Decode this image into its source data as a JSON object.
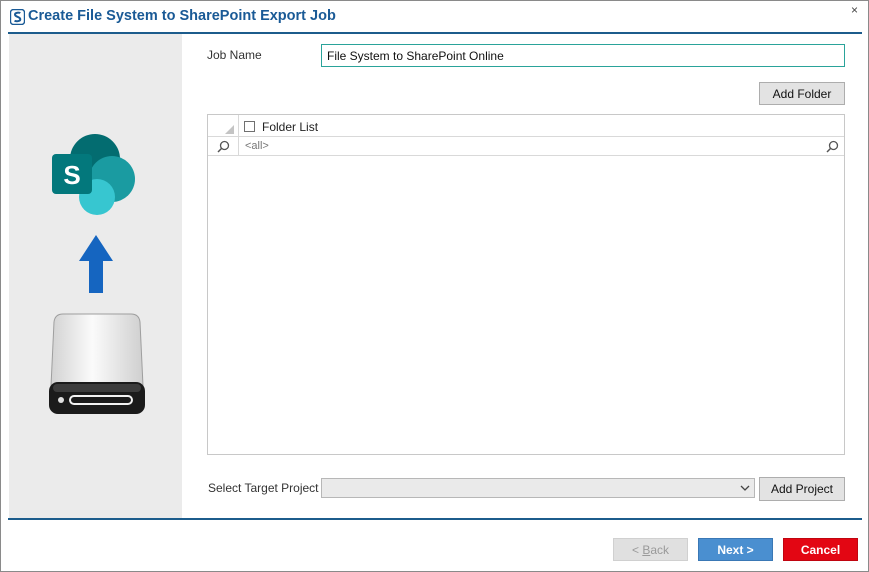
{
  "window": {
    "title": "Create File System to SharePoint Export Job",
    "close_glyph": "×"
  },
  "form": {
    "job_name_label": "Job Name",
    "job_name_value": "File System to SharePoint Online",
    "add_folder_label": "Add Folder",
    "folder_grid": {
      "column_header": "Folder List",
      "filter_placeholder": "<all>",
      "rows": []
    },
    "target_project_label": "Select Target Project",
    "target_project_value": "",
    "add_project_label": "Add Project"
  },
  "footer": {
    "back_prefix": "< ",
    "back_accel": "B",
    "back_rest": "ack",
    "next_label": "Next >",
    "cancel_label": "Cancel"
  },
  "left_panel": {
    "icons": [
      "sharepoint-logo-icon",
      "up-arrow-icon",
      "hard-drive-icon"
    ],
    "sharepoint_letter": "S"
  },
  "colors": {
    "title_blue": "#1a5a96",
    "rule_blue": "#1c5c8c",
    "next_blue": "#4a8fd0",
    "cancel_red": "#e30613",
    "input_border_teal": "#2aa39a",
    "sharepoint_dark_teal": "#036c70",
    "sharepoint_teal": "#1a9ba1",
    "sharepoint_light_teal": "#37c6d0",
    "arrow_blue": "#1565c0"
  }
}
